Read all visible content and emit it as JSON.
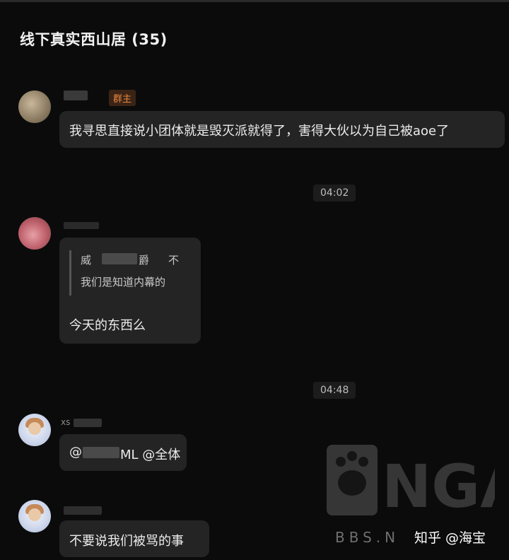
{
  "chat": {
    "title": "线下真实西山居 (35)"
  },
  "messages": [
    {
      "badge": "群主",
      "text": "我寻思直接说小团体就是毁灭派就得了，害得大伙以为自己被aoe了"
    },
    {
      "quote": {
        "name_start": "威",
        "name_end": "爵",
        "tag": "不",
        "text": "我们是知道内幕的"
      },
      "text": "今天的东西么"
    },
    {
      "sender_prefix": "xs",
      "at_prefix": "@",
      "at_suffix": "ML @全体"
    },
    {
      "text": "不要说我们被骂的事"
    }
  ],
  "times": [
    "04:02",
    "04:48"
  ],
  "watermark": {
    "logo_text": "NGA",
    "site": "BBS.N",
    "source": "知乎 @海宝"
  },
  "colors": {
    "background": "#0b0b0b",
    "bubble": "#242424",
    "badge_text": "#e8873f",
    "badge_bg": "#3b2416"
  }
}
